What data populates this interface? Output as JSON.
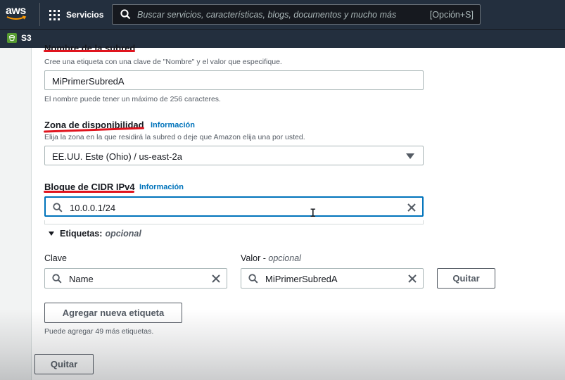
{
  "topnav": {
    "logo_text": "aws",
    "services_label": "Servicios",
    "search_placeholder": "Buscar servicios, características, blogs, documentos y mucho más",
    "search_shortcut": "[Opción+S]"
  },
  "favorites": {
    "items": [
      {
        "label": "S3",
        "icon": "s3-icon"
      }
    ]
  },
  "form": {
    "subnet_name": {
      "label": "Nombre de la subred",
      "description": "Cree una etiqueta con una clave de \"Nombre\" y el valor que especifique.",
      "value": "MiPrimerSubredA",
      "hint": "El nombre puede tener un máximo de 256 caracteres."
    },
    "availability_zone": {
      "label": "Zona de disponibilidad",
      "info": "Información",
      "description": "Elija la zona en la que residirá la subred o deje que Amazon elija una por usted.",
      "selected": "EE.UU. Este (Ohio) / us-east-2a"
    },
    "cidr_block": {
      "label": "Bloque de CIDR IPv4",
      "info": "Información",
      "value": "10.0.0.1/24"
    },
    "tags": {
      "expander_label": "Etiquetas:",
      "expander_optional": "opcional",
      "key_label": "Clave",
      "value_label": "Valor - ",
      "value_optional": "opcional",
      "rows": [
        {
          "key": "Name",
          "value": "MiPrimerSubredA",
          "remove_label": "Quitar"
        }
      ],
      "add_button": "Agregar nueva etiqueta",
      "remaining_hint": "Puede agregar 49 más etiquetas."
    },
    "remove_subnet_button": "Quitar"
  },
  "colors": {
    "nav_bg": "#232f3e",
    "link": "#0073bb",
    "annotation_red": "#e0141e",
    "focus": "#0073bb"
  }
}
